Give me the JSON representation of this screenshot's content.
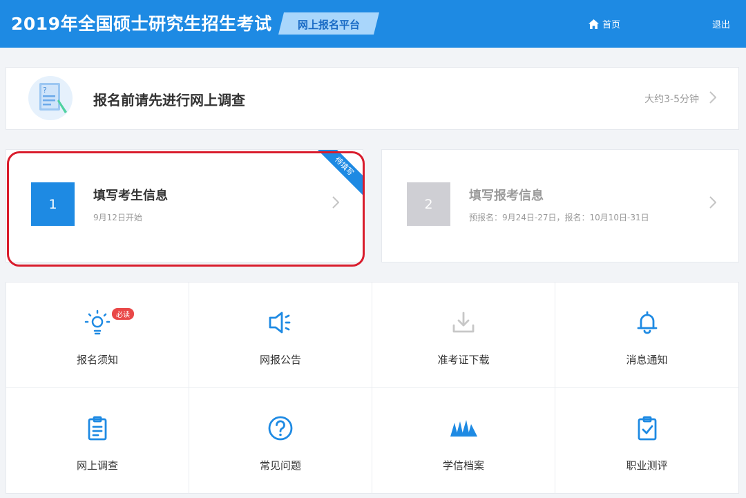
{
  "header": {
    "title": "2019年全国硕士研究生招生考试",
    "platform": "网上报名平台",
    "home_label": "首页",
    "logout_label": "退出"
  },
  "survey": {
    "title": "报名前请先进行网上调查",
    "hint": "大约3-5分钟"
  },
  "steps": [
    {
      "number": "1",
      "title": "填写考生信息",
      "subtitle": "9月12日开始",
      "ribbon": "待填写"
    },
    {
      "number": "2",
      "title": "填写报考信息",
      "subtitle": "预报名：9月24日-27日，报名：10月10日-31日"
    }
  ],
  "grid": [
    {
      "label": "报名须知",
      "icon": "lightbulb-icon",
      "badge": "必读"
    },
    {
      "label": "网报公告",
      "icon": "megaphone-icon"
    },
    {
      "label": "准考证下载",
      "icon": "download-icon"
    },
    {
      "label": "消息通知",
      "icon": "bell-icon"
    },
    {
      "label": "网上调查",
      "icon": "clipboard-icon"
    },
    {
      "label": "常见问题",
      "icon": "question-icon"
    },
    {
      "label": "学信档案",
      "icon": "archive-icon"
    },
    {
      "label": "职业测评",
      "icon": "clipboard-check-icon"
    }
  ],
  "colors": {
    "primary": "#1e8ae3",
    "highlight": "#d91c2c",
    "disabled": "#cfcfd4"
  }
}
